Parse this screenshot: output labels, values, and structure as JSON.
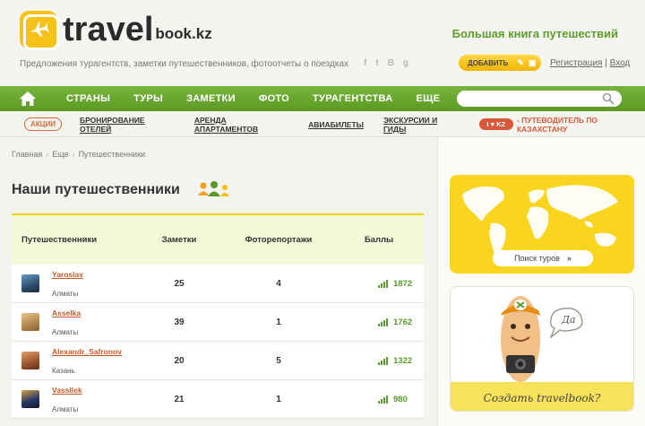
{
  "header": {
    "logo_travel": "travel",
    "logo_bookkz": "book.kz",
    "tagline": "Большая книга путешествий",
    "subtitle": "Предложения турагентств, заметки путешественников, фотоотчеты о поездках",
    "social": [
      "f",
      "t",
      "B",
      "g"
    ],
    "add_label": "ДОБАВИТЬ",
    "register": "Регистрация",
    "divider": "|",
    "login": "Вход"
  },
  "nav": {
    "items": [
      "СТРАНЫ",
      "ТУРЫ",
      "ЗАМЕТКИ",
      "ФОТО",
      "ТУРАГЕНТСТВА",
      "ЕЩЕ"
    ],
    "search_placeholder": ""
  },
  "subnav": {
    "promo": "АКЦИИ",
    "items": [
      "БРОНИРОВАНИЕ ОТЕЛЕЙ",
      "АРЕНДА АПАРТАМЕНТОВ",
      "АВИАБИЛЕТЫ",
      "ЭКСКУРСИИ И ГИДЫ"
    ],
    "kz_pill": "I ♥ KZ",
    "kz_guide": "- ПУТЕВОДИТЕЛЬ ПО КАЗАХСТАНУ"
  },
  "breadcrumb": [
    "Главная",
    "Еще",
    "Путешественники"
  ],
  "page": {
    "title": "Наши путешественники"
  },
  "table": {
    "headers": {
      "user": "Путешественники",
      "notes": "Заметки",
      "photo": "Фоторепортажи",
      "points": "Баллы"
    },
    "rows": [
      {
        "name": "Yaroslav",
        "city": "Алматы",
        "notes": "25",
        "photo": "4",
        "points": "1872",
        "avatar_color": "#3d6b8c"
      },
      {
        "name": "Asselka",
        "city": "Алматы",
        "notes": "39",
        "photo": "1",
        "points": "1762",
        "avatar_color": "#c9a06a"
      },
      {
        "name": "Alexandr_Safronov",
        "city": "Казань",
        "notes": "20",
        "photo": "5",
        "points": "1322",
        "avatar_color": "#b86a3a"
      },
      {
        "name": "Vassilek",
        "city": "Алматы",
        "notes": "21",
        "photo": "1",
        "points": "980",
        "avatar_color": "#2a3a6a"
      }
    ]
  },
  "sidebar": {
    "tours_btn": "Поиск туров",
    "bubble": "Да",
    "promo_text": "Создать travelbook?"
  },
  "colors": {
    "brand_green": "#5e9e2c",
    "brand_yellow": "#f6c21a",
    "accent_orange": "#c45a2a"
  }
}
